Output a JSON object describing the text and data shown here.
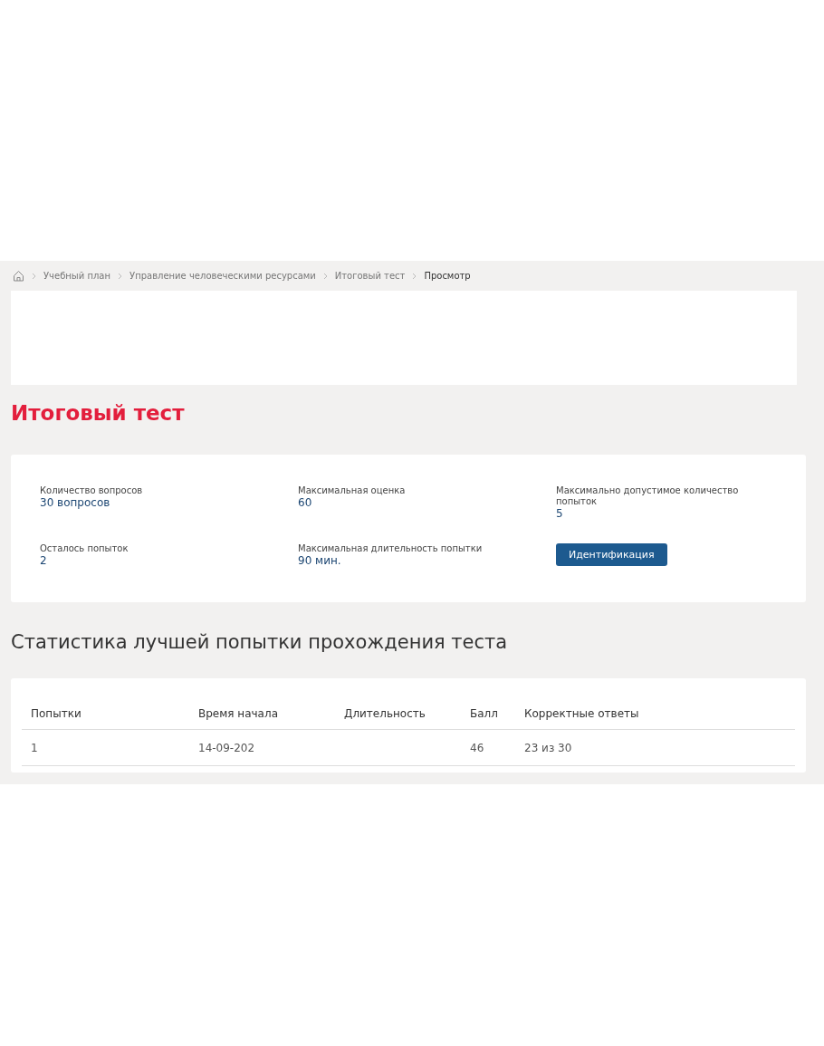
{
  "breadcrumbs": [
    "Учебный план",
    "Управление человеческими ресурсами",
    "Итоговый тест",
    "Просмотр"
  ],
  "title": "Итоговый тест",
  "info": [
    {
      "label": "Количество вопросов",
      "value": "30 вопросов",
      "kind": "text"
    },
    {
      "label": "Максимальная оценка",
      "value": "60",
      "kind": "text"
    },
    {
      "label": "Максимально допустимое количество попыток",
      "value": "5",
      "kind": "text"
    },
    {
      "label": "Осталось попыток",
      "value": "2",
      "kind": "text"
    },
    {
      "label": "Максимальная длительность попытки",
      "value": "90 мин.",
      "kind": "text"
    },
    {
      "label": "Идентификация",
      "kind": "button"
    }
  ],
  "stats_title": "Статистика лучшей попытки прохождения теста",
  "table": {
    "columns": [
      "Попытки",
      "Время начала",
      "Длительность",
      "Балл",
      "Корректные ответы"
    ],
    "rows": [
      [
        "1",
        "14-09-202",
        "",
        "46",
        "23 из 30"
      ]
    ]
  }
}
